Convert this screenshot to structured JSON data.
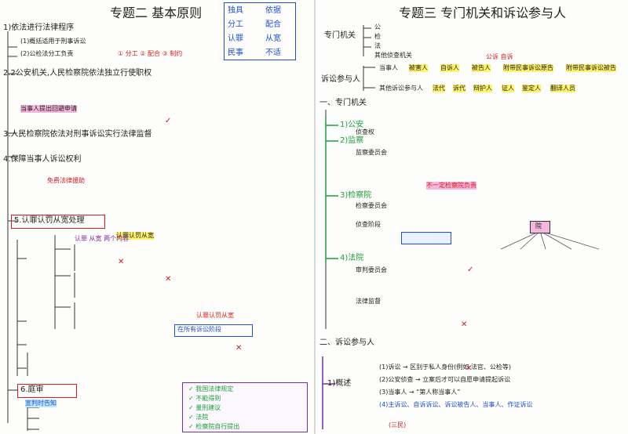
{
  "left_page": {
    "title": "专题二 基本原则",
    "title_box_items": [
      "独具",
      "依据",
      "分工",
      "配合",
      "认罪",
      "从宽",
      "民事",
      "不适"
    ],
    "lines": {
      "l1": "1)依法进行法律程序",
      "l2": "2.2公安机关,人民检察院依法独立行使职权",
      "l3": "3.人民检察院依法对刑事诉讼实行法律监督",
      "l4": "4.保障当事人诉讼权利",
      "l5": "5.认罪认罚从宽处理",
      "l6": "6.庭审",
      "l6b": "宣判时告知",
      "sub_a": "(1)概括适用于刑事诉讼",
      "sub_b": "(2)公检法分工负责",
      "sub_c": "① 分工 ② 配合 ③ 制约",
      "note_accept": "当事人提出回避申请",
      "note_free": "免费法律援助",
      "note_confirm": "认罪认罚从宽",
      "note_both": "认罪 从宽 两个内容",
      "note_end": "在所有诉讼阶段",
      "note_left": "认罪认罚从宽"
    },
    "legend": [
      "我国法律规定",
      "不能得到",
      "量刑建议",
      "法院",
      "检察院自行提出"
    ]
  },
  "right_page": {
    "title": "专题三 专门机关和诉讼参与人",
    "top": {
      "org_label": "专门机关",
      "org_list": [
        "公",
        "检",
        "法",
        "其他侦查机关"
      ],
      "party_label": "诉讼参与人",
      "party_a": "当事人",
      "party_a_items": [
        "被害人",
        "自诉人",
        "被告人",
        "附带民事诉讼原告",
        "附带民事诉讼被告"
      ],
      "party_b": "其他诉讼参与人",
      "party_b_items": [
        "法代",
        "诉代",
        "辩护人",
        "证人",
        "鉴定人",
        "翻译人员"
      ],
      "note": "公诉 自诉"
    },
    "sec1": {
      "heading": "一、专门机关",
      "items": [
        "1)公安",
        "2)监察",
        "3)检察院",
        "4)法院"
      ],
      "sub": [
        "侦查权",
        "监察委员会",
        "检察委员会",
        "侦查阶段",
        "审判委员会",
        "法律监督"
      ],
      "box_text": "不一定检察院负责",
      "tag": "院"
    },
    "sec2": {
      "heading": "二、诉讼参与人",
      "item1": "1)概述",
      "lines": [
        "(1)诉讼 → 区别于私人身份(例如:法官、公检等)",
        "(2)公安侦查 → 立案后才可以自愿申请提起诉讼",
        "(3)当事人 → “第人称当事人”",
        "(4)主诉讼、自诉诉讼、诉讼被告人、当事人、作证诉讼"
      ],
      "bottom": "(三民)"
    }
  }
}
